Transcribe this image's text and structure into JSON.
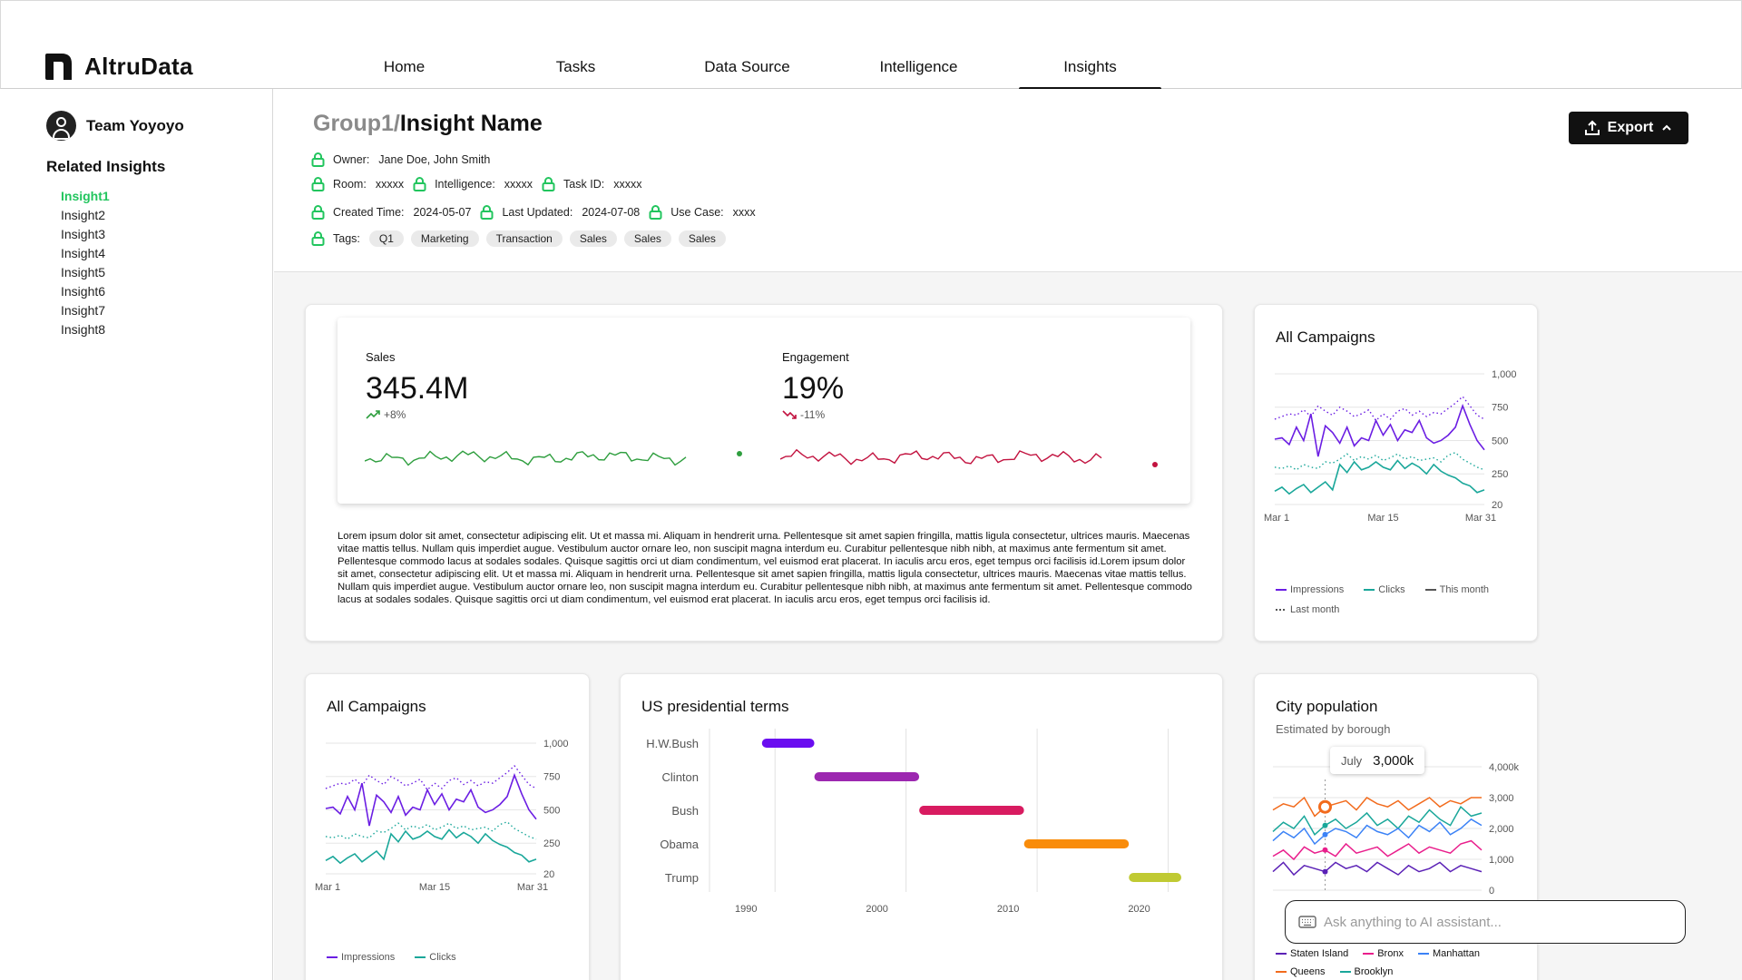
{
  "app": {
    "name": "AltruData"
  },
  "nav": [
    {
      "label": "Home"
    },
    {
      "label": "Tasks"
    },
    {
      "label": "Data Source"
    },
    {
      "label": "Intelligence"
    },
    {
      "label": "Insights",
      "active": true
    }
  ],
  "sidebar": {
    "team": "Team Yoyoyo",
    "related_title": "Related Insights",
    "insights": [
      "Insight1",
      "Insight2",
      "Insight3",
      "Insight4",
      "Insight5",
      "Insight6",
      "Insight7",
      "Insight8"
    ],
    "active_insight": "Insight1"
  },
  "header": {
    "group": "Group1/",
    "title": "Insight Name",
    "owner_label": "Owner:",
    "owner": "Jane Doe, John Smith",
    "room_label": "Room:",
    "room": "xxxxx",
    "intelligence_label": "Intelligence:",
    "intelligence": "xxxxx",
    "task_label": "Task ID:",
    "task": "xxxxx",
    "created_label": "Created Time:",
    "created": "2024-05-07",
    "updated_label": "Last Updated:",
    "updated": "2024-07-08",
    "usecase_label": "Use Case:",
    "usecase": "xxxx",
    "tags_label": "Tags:",
    "tags": [
      "Q1",
      "Marketing",
      "Transaction",
      "Sales",
      "Sales",
      "Sales"
    ],
    "export_label": "Export"
  },
  "kpis": {
    "sales": {
      "label": "Sales",
      "value": "345.4M",
      "delta": "+8%",
      "color": "#2e9e3e"
    },
    "engagement": {
      "label": "Engagement",
      "value": "19%",
      "delta": "-11%",
      "color": "#c2123f"
    }
  },
  "lorem": "Lorem ipsum dolor sit amet, consectetur adipiscing elit. Ut et massa mi. Aliquam in hendrerit urna. Pellentesque sit amet sapien fringilla, mattis ligula consectetur, ultrices mauris. Maecenas vitae mattis tellus. Nullam quis imperdiet augue. Vestibulum auctor ornare leo, non suscipit magna interdum eu. Curabitur pellentesque nibh nibh, at maximus ante fermentum sit amet. Pellentesque commodo lacus at sodales sodales. Quisque sagittis orci ut diam condimentum, vel euismod erat placerat. In iaculis arcu eros, eget tempus orci facilisis id.Lorem ipsum dolor sit amet, consectetur adipiscing elit. Ut et massa mi. Aliquam in hendrerit urna. Pellentesque sit amet sapien fringilla, mattis ligula consectetur, ultrices mauris. Maecenas vitae mattis tellus. Nullam quis imperdiet augue. Vestibulum auctor ornare leo, non suscipit magna interdum eu. Curabitur pellentesque nibh nibh, at maximus ante fermentum sit amet. Pellentesque commodo lacus at sodales sodales. Quisque sagittis orci ut diam condimentum, vel euismod erat placerat. In iaculis arcu eros, eget tempus orci facilisis id.",
  "campaigns": {
    "title": "All Campaigns",
    "legend": {
      "impressions": "Impressions",
      "clicks": "Clicks",
      "this_month": "This month",
      "last_month": "Last month"
    }
  },
  "gantt": {
    "title": "US presidential terms"
  },
  "city": {
    "title": "City population",
    "subtitle": "Estimated by borough",
    "tooltip_month": "July",
    "tooltip_value": "3,000k",
    "legend": [
      "Staten Island",
      "Bronx",
      "Manhattan",
      "Queens",
      "Brooklyn"
    ]
  },
  "ai": {
    "placeholder": "Ask anything to AI assistant..."
  },
  "colors": {
    "accent_green": "#22c55e",
    "purple": "#6b1ee3",
    "teal": "#1aa79a",
    "sales_green": "#2e9e3e",
    "engagement_red": "#c2123f"
  },
  "chart_data": [
    {
      "type": "line",
      "title": "",
      "x": [
        "Mar 1",
        "Mar 15",
        "Mar 31"
      ],
      "ylim": [
        20,
        1000
      ],
      "yticks": [
        "1,000",
        "750",
        "500",
        "250",
        "20"
      ],
      "series": [
        {
          "name": "Impressions",
          "style": "This month",
          "values": [
            510,
            520,
            470,
            600,
            500,
            700,
            380,
            610,
            560,
            480,
            600,
            460,
            520,
            500,
            650,
            540,
            620,
            500,
            580,
            560,
            650,
            520,
            480,
            500,
            540,
            600,
            760,
            620,
            500,
            430
          ]
        },
        {
          "name": "Impressions",
          "style": "Last month",
          "values": [
            660,
            680,
            700,
            690,
            730,
            680,
            760,
            720,
            690,
            750,
            720,
            680,
            700,
            730,
            650,
            700,
            660,
            720,
            740,
            690,
            720,
            680,
            710,
            700,
            740,
            780,
            830,
            760,
            690,
            660
          ]
        },
        {
          "name": "Clicks",
          "style": "This month",
          "values": [
            120,
            150,
            100,
            140,
            170,
            110,
            150,
            190,
            130,
            320,
            260,
            340,
            280,
            300,
            340,
            300,
            280,
            350,
            290,
            330,
            300,
            250,
            320,
            270,
            240,
            220,
            180,
            160,
            110,
            130
          ]
        },
        {
          "name": "Clicks",
          "style": "Last month",
          "values": [
            300,
            290,
            310,
            280,
            320,
            300,
            290,
            340,
            330,
            360,
            400,
            350,
            380,
            360,
            390,
            350,
            370,
            400,
            360,
            380,
            350,
            360,
            370,
            340,
            390,
            410,
            360,
            330,
            300,
            280
          ]
        }
      ]
    },
    {
      "type": "bar",
      "title": "US presidential terms",
      "categories": [
        "H.W.Bush",
        "Clinton",
        "Bush",
        "Obama",
        "Trump"
      ],
      "start": [
        1989,
        1993,
        2001,
        2009,
        2017
      ],
      "end": [
        1993,
        2001,
        2009,
        2017,
        2021
      ],
      "xticks": [
        "1990",
        "2000",
        "2010",
        "2020"
      ],
      "colors": [
        "#6a0df0",
        "#9c27b0",
        "#d81b60",
        "#f98c0a",
        "#c0ca33"
      ]
    },
    {
      "type": "line",
      "title": "City population",
      "subtitle": "Estimated by borough",
      "ylim": [
        0,
        4000
      ],
      "yticks": [
        "4,000k",
        "3,000",
        "2,000",
        "1,000",
        "0"
      ],
      "series": [
        {
          "name": "Queens",
          "color": "#f26b1d",
          "values": [
            2600,
            2800,
            2700,
            3000,
            2400,
            2700,
            2800,
            2900,
            2600,
            3000,
            2800,
            2700,
            2900,
            2600,
            2800,
            3000,
            2700,
            2900,
            2800,
            3000,
            3000
          ]
        },
        {
          "name": "Brooklyn",
          "color": "#1aa79a",
          "values": [
            1900,
            2200,
            2000,
            2400,
            1800,
            2100,
            2300,
            2000,
            2200,
            2500,
            2100,
            2300,
            2000,
            2400,
            2200,
            2600,
            2300,
            2100,
            2700,
            2400,
            2500
          ]
        },
        {
          "name": "Manhattan",
          "color": "#3b82f6",
          "values": [
            1600,
            1900,
            1700,
            2000,
            1500,
            1800,
            2000,
            1900,
            1700,
            2100,
            1900,
            1800,
            2000,
            1700,
            2100,
            1900,
            2200,
            1800,
            2000,
            2300,
            2100
          ]
        },
        {
          "name": "Bronx",
          "color": "#e91e8c",
          "values": [
            1100,
            1300,
            1000,
            1400,
            1200,
            1300,
            1100,
            1500,
            1200,
            1300,
            1400,
            1100,
            1300,
            1500,
            1200,
            1400,
            1300,
            1200,
            1500,
            1600,
            1300
          ]
        },
        {
          "name": "Staten Island",
          "color": "#5b21b6",
          "values": [
            600,
            900,
            500,
            800,
            700,
            600,
            900,
            700,
            800,
            600,
            900,
            700,
            500,
            800,
            600,
            700,
            900,
            600,
            800,
            700,
            600
          ]
        }
      ]
    }
  ]
}
